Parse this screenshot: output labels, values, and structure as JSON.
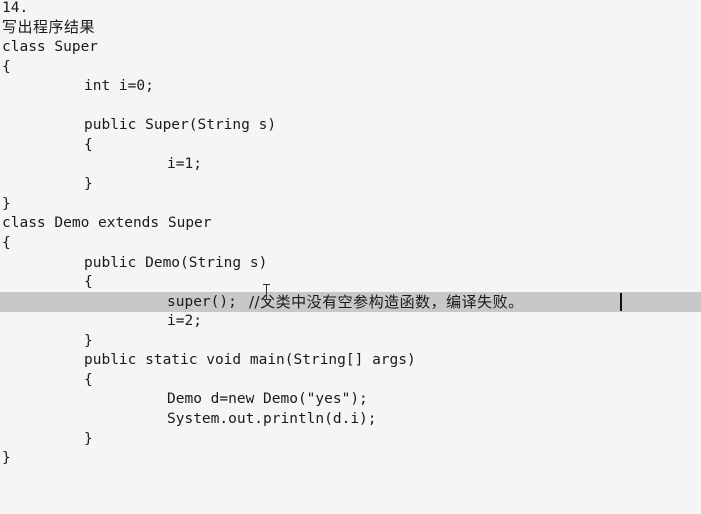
{
  "header": {
    "number": "14.",
    "instruction": "写出程序结果"
  },
  "code": {
    "l01": "class Super",
    "l02": "{",
    "l03": "int i=0;",
    "l04": "public Super(String s)",
    "l05": "{",
    "l06": "i=1;",
    "l07": "}",
    "l08": "}",
    "l09": "class Demo extends Super",
    "l10": "{",
    "l11": "public Demo(String s)",
    "l12": "{",
    "l13_code": "super();",
    "l13_comment": "//父类中没有空参构造函数，编译失败。",
    "l14": "i=2;",
    "l15": "}",
    "l16": "public static void main(String[] args)",
    "l17": "{",
    "l18": "Demo d=new Demo(\"yes\");",
    "l19": "System.out.println(d.i);",
    "l20": "}",
    "l21": "}"
  },
  "cursor": {
    "active_line_highlight_color": "#c8c8c8",
    "pointer": "ibeam-cursor-icon"
  }
}
